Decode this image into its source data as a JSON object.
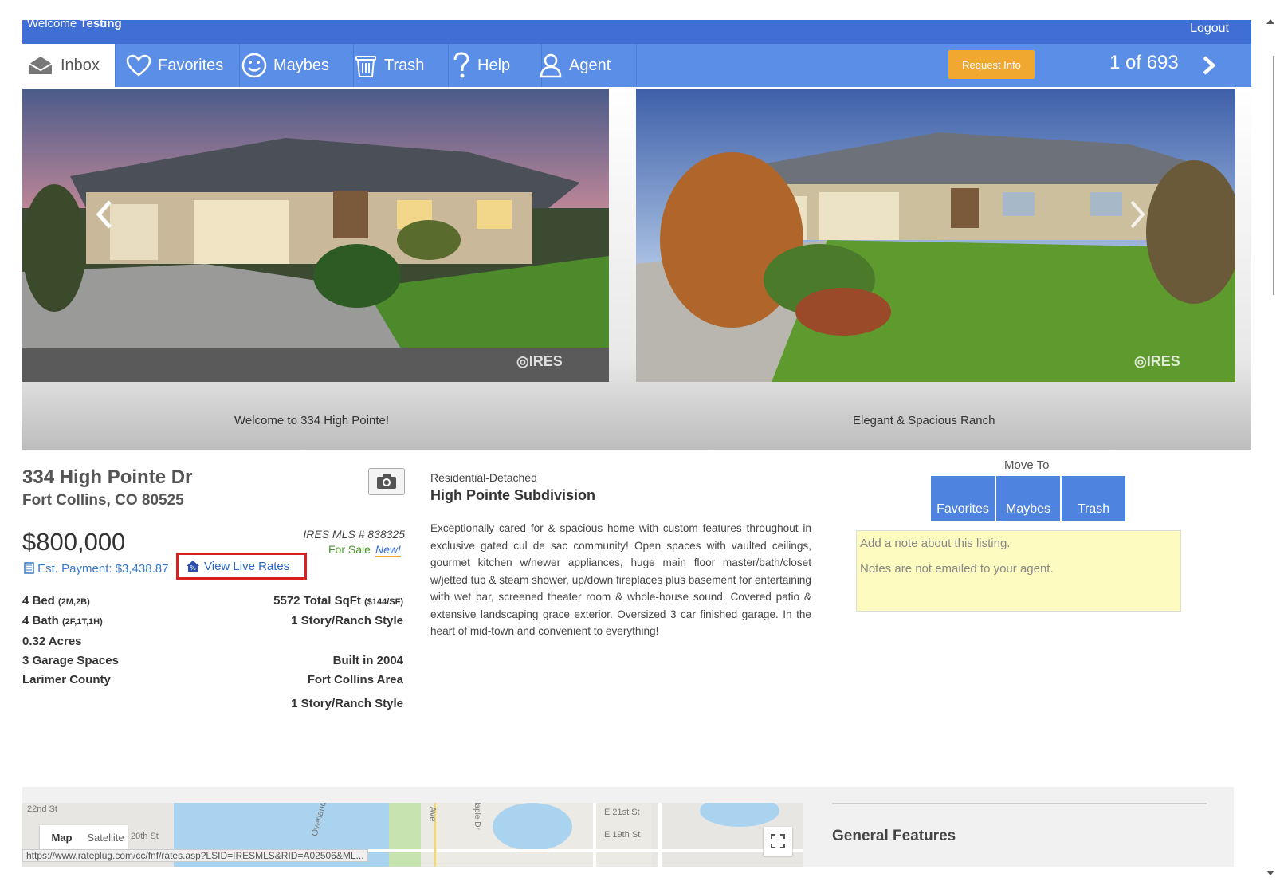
{
  "header": {
    "welcome_prefix": "Welcome",
    "user": "Testing",
    "logout": "Logout"
  },
  "nav": {
    "items": [
      {
        "label": "Inbox",
        "icon": "inbox-icon"
      },
      {
        "label": "Favorites",
        "icon": "heart-icon"
      },
      {
        "label": "Maybes",
        "icon": "smiley-icon"
      },
      {
        "label": "Trash",
        "icon": "trash-icon"
      },
      {
        "label": "Help",
        "icon": "question-icon"
      },
      {
        "label": "Agent",
        "icon": "person-icon"
      }
    ],
    "request_info": "Request Info",
    "pager": "1 of 693"
  },
  "photos": {
    "left_caption": "Welcome to 334 High Pointe!",
    "right_caption": "Elegant & Spacious Ranch",
    "watermark": "IRES"
  },
  "listing": {
    "address_line1": "334 High Pointe Dr",
    "address_line2": "Fort Collins, CO 80525",
    "price": "$800,000",
    "mls": "IRES MLS # 838325",
    "status": "For Sale",
    "new_tag": "New!",
    "est_payment": "Est. Payment: $3,438.87",
    "live_rates": "View Live Rates",
    "specs_left": [
      {
        "main": "4 Bed",
        "small": "(2M,2B)"
      },
      {
        "main": "4 Bath",
        "small": "(2F,1T,1H)"
      },
      {
        "main": "0.32 Acres",
        "small": ""
      },
      {
        "main": "3 Garage Spaces",
        "small": ""
      },
      {
        "main": "Larimer County",
        "small": ""
      }
    ],
    "specs_right": [
      {
        "main": "5572 Total SqFt",
        "small": "($144/SF)"
      },
      {
        "main": "1 Story/Ranch Style",
        "small": ""
      },
      {
        "main": "Built in 2004",
        "small": ""
      },
      {
        "main": "Fort Collins Area",
        "small": ""
      },
      {
        "main": "1 Story/Ranch Style",
        "small": ""
      }
    ],
    "property_type": "Residential-Detached",
    "subdivision": "High Pointe Subdivision",
    "description": "Exceptionally cared for & spacious home with custom features throughout in exclusive gated cul de sac community! Open spaces with vaulted ceilings, gourmet kitchen w/newer appliances, huge main floor master/bath/closet w/jetted tub & steam shower, up/down fireplaces plus basement for entertaining with wet bar, screened theater room & whole-house sound. Covered patio & extensive landscaping grace exterior. Oversized 3 car finished garage. In the heart of mid-town and convenient to everything!"
  },
  "move_to": {
    "title": "Move To",
    "buttons": [
      "Favorites",
      "Maybes",
      "Trash"
    ]
  },
  "note": {
    "placeholder": "Add a note about this listing.",
    "hint": "Notes are not emailed to your agent."
  },
  "map": {
    "map_label": "Map",
    "satellite_label": "Satellite",
    "streets": [
      "22nd St",
      "20th St",
      "Overland",
      "Ave",
      "Maple Dr",
      "E 21st St",
      "E 19th St"
    ]
  },
  "general_features": "General Features",
  "status_url": "https://www.rateplug.com/cc/fnf/rates.asp?LSID=IRESMLS&RID=A02506&ML..."
}
